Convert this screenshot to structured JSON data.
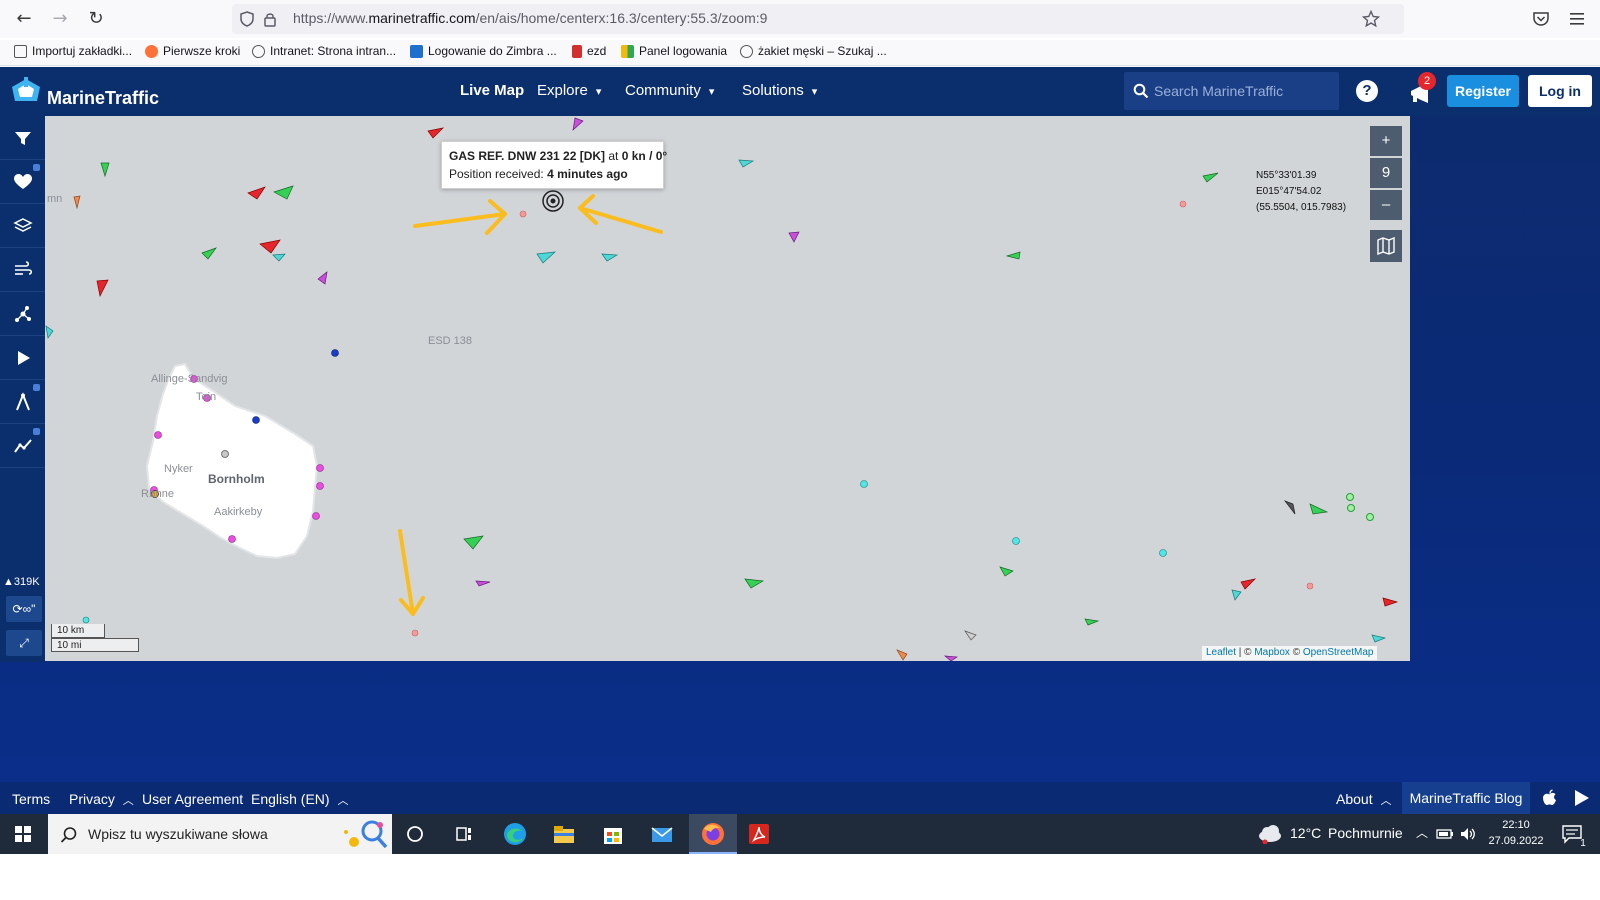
{
  "browser": {
    "url_prefix": "https://www.",
    "url_domain": "marinetraffic.com",
    "url_path": "/en/ais/home/centerx:16.3/centery:55.3/zoom:9",
    "bookmarks": [
      {
        "label": "Importuj zakładki...",
        "icon": "import-icon",
        "color": "#555555"
      },
      {
        "label": "Pierwsze kroki",
        "icon": "firefox-icon",
        "color": "#ff7139"
      },
      {
        "label": "Intranet: Strona intran...",
        "icon": "globe-icon",
        "color": "#555555"
      },
      {
        "label": "Logowanie do Zimbra ...",
        "icon": "zimbra-icon",
        "color": "#1e6fd0"
      },
      {
        "label": "ezd",
        "icon": "ezd-icon",
        "color": "#d32f2f"
      },
      {
        "label": "Panel logowania",
        "icon": "panel-icon",
        "color": "#f2b90c"
      },
      {
        "label": "żakiet męski – Szukaj ...",
        "icon": "globe-icon",
        "color": "#555555"
      }
    ]
  },
  "header": {
    "logo": "MarineTraffic",
    "nav": {
      "live_map": "Live Map",
      "explore": "Explore",
      "community": "Community",
      "solutions": "Solutions"
    },
    "search_placeholder": "Search MarineTraffic",
    "help": "?",
    "notification_count": "2",
    "register": "Register",
    "login": "Log in"
  },
  "sidebar": {
    "items": [
      {
        "icon": "filter-icon"
      },
      {
        "icon": "heart-icon",
        "locked": true
      },
      {
        "icon": "layers-icon"
      },
      {
        "icon": "wind-icon"
      },
      {
        "icon": "density-icon"
      },
      {
        "icon": "play-icon"
      },
      {
        "icon": "route-icon",
        "locked": true
      },
      {
        "icon": "analytics-icon",
        "locked": true
      }
    ],
    "vessel_count": "319K",
    "refresh_label": "∞\"",
    "fullscreen": "fullscreen-icon"
  },
  "map": {
    "tooltip": {
      "vessel": "GAS REF. DNW 231 22 [DK]",
      "at": "at",
      "speed": "0 kn / 0°",
      "received_label": "Position received:",
      "received_value": "4 minutes ago"
    },
    "coords": {
      "lat": "N55°33'01.39",
      "lon": "E015°47'54.02",
      "decimal": "(55.5504, 015.7983)"
    },
    "zoom_in": "+",
    "zoom_level": "9",
    "zoom_out": "–",
    "scale_km": "10 km",
    "scale_mi": "10 mi",
    "labels": {
      "esd": "ESD 138",
      "bornholm": "Bornholm",
      "allinge": "Allinge-Sandvig",
      "tein": "Tein",
      "nyker": "Nyker",
      "ronne": "Rønne",
      "aakirkeby": "Aakirkeby",
      "edge": "mn"
    },
    "attribution": {
      "leaflet": "Leaflet",
      "sep1": " | © ",
      "mapbox": "Mapbox",
      "sep2": " © ",
      "osm": "OpenStreetMap"
    }
  },
  "footer": {
    "terms": "Terms",
    "privacy": "Privacy",
    "user_agreement": "User Agreement",
    "language": "English (EN)",
    "about": "About",
    "blog": "MarineTraffic Blog"
  },
  "taskbar": {
    "search_placeholder": "Wpisz tu wyszukiwane słowa",
    "weather_temp": "12°C",
    "weather_desc": "Pochmurnie",
    "time": "22:10",
    "date": "27.09.2022",
    "notif_count": "1"
  },
  "colors": {
    "header_bg": "#0b2e6d",
    "map_bg": "#d1d5d8",
    "register_bg": "#1a8fe0",
    "arrow": "#fbbd1e"
  }
}
